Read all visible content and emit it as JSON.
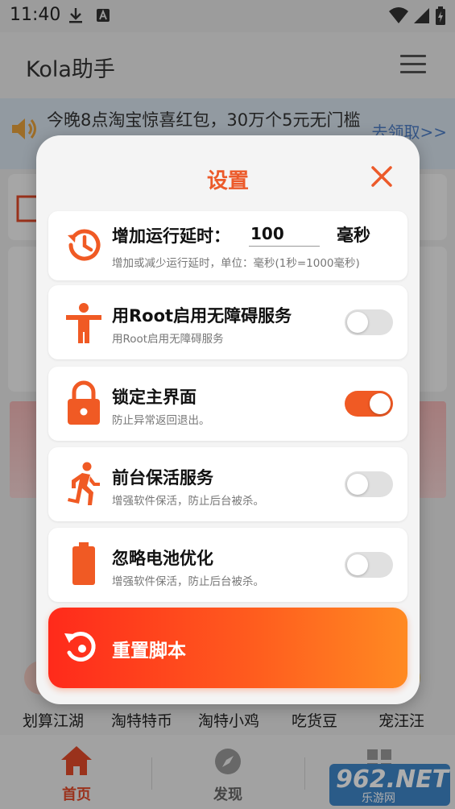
{
  "status_bar": {
    "time": "11:40"
  },
  "app": {
    "title": "Kola助手",
    "menu_icon": "hamburger-menu-icon"
  },
  "notice": {
    "text": "今晚8点淘宝惊喜红包，30万个5元无门槛",
    "link": "去领取>>",
    "icon": "speaker-icon"
  },
  "grid": {
    "items": [
      {
        "label": "划算江湖"
      },
      {
        "label": "淘特特币"
      },
      {
        "label": "淘特小鸡"
      },
      {
        "label": "吃货豆"
      },
      {
        "label": "宠汪汪"
      }
    ]
  },
  "bottom_nav": {
    "items": [
      {
        "label": "首页",
        "icon": "home-icon",
        "active": true
      },
      {
        "label": "发现",
        "icon": "compass-icon",
        "active": false
      }
    ]
  },
  "watermark": {
    "big": "962.NET",
    "small": "乐游网"
  },
  "dialog": {
    "title": "设置",
    "delay": {
      "title": "增加运行延时：",
      "value": "100",
      "unit": "毫秒",
      "subtitle": "增加或减少运行延时，单位：毫秒(1秒=1000毫秒)",
      "icon": "history-clock-icon"
    },
    "settings": [
      {
        "title": "用Root启用无障碍服务",
        "subtitle": "用Root启用无障碍服务",
        "icon": "accessibility-person-icon",
        "enabled": false
      },
      {
        "title": "锁定主界面",
        "subtitle": "防止异常返回退出。",
        "icon": "lock-icon",
        "enabled": true
      },
      {
        "title": "前台保活服务",
        "subtitle": "增强软件保活，防止后台被杀。",
        "icon": "running-person-icon",
        "enabled": false
      },
      {
        "title": "忽略电池优化",
        "subtitle": "增强软件保活，防止后台被杀。",
        "icon": "battery-icon",
        "enabled": false
      }
    ],
    "reset_label": "重置脚本",
    "reset_icon": "reset-restore-icon"
  },
  "colors": {
    "accent": "#f05a24",
    "title": "#ec5a2a",
    "link": "#4e7fc7"
  }
}
